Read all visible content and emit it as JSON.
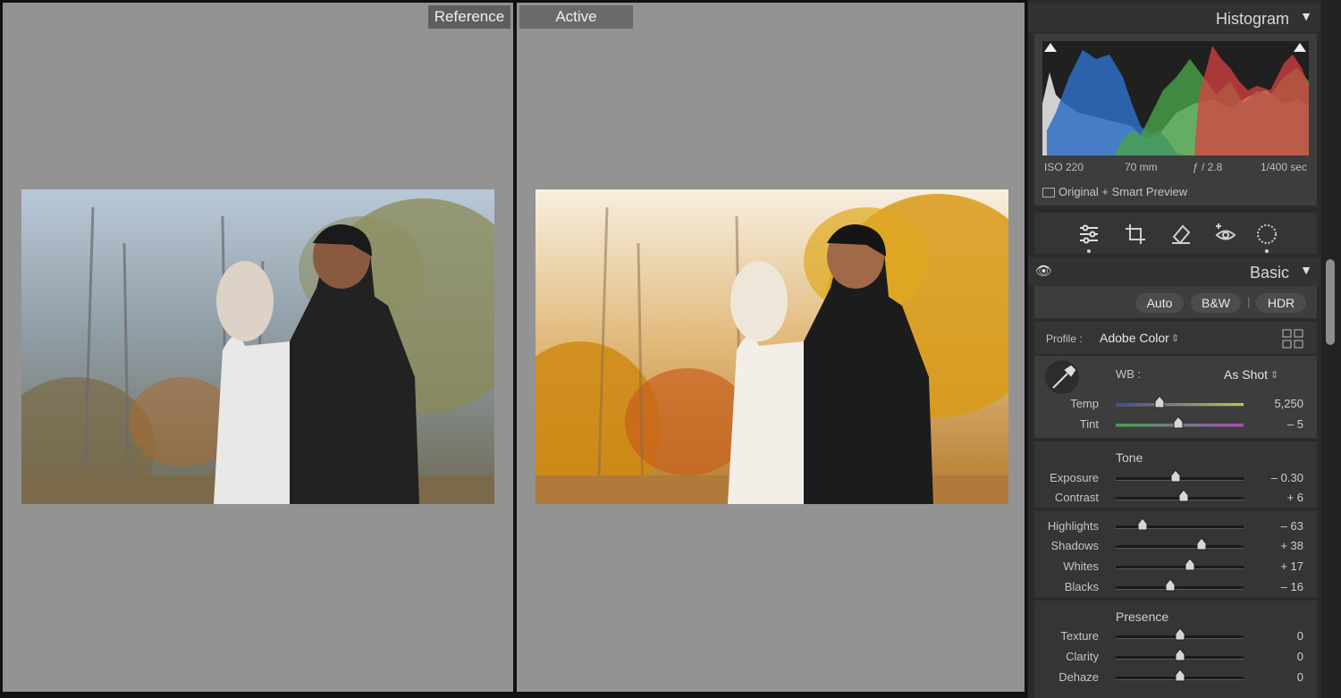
{
  "compare": {
    "reference_label": "Reference",
    "active_label": "Active"
  },
  "histogram": {
    "title": "Histogram",
    "iso": "ISO 220",
    "focal": "70 mm",
    "aperture": "ƒ / 2.8",
    "shutter": "1/400 sec",
    "preview": "Original + Smart Preview"
  },
  "tools": [
    "edit-icon",
    "crop-icon",
    "heal-icon",
    "redeye-icon",
    "mask-icon"
  ],
  "basic": {
    "title": "Basic",
    "auto": "Auto",
    "bw": "B&W",
    "separator": "|",
    "hdr": "HDR",
    "profile_label": "Profile :",
    "profile_value": "Adobe Color",
    "wb_label": "WB :",
    "wb_value": "As Shot",
    "temp": {
      "label": "Temp",
      "value": "5,250",
      "position": 0.34
    },
    "tint": {
      "label": "Tint",
      "value": "– 5",
      "position": 0.49
    },
    "tone_title": "Tone",
    "exposure": {
      "label": "Exposure",
      "value": "– 0.30",
      "position": 0.47
    },
    "contrast": {
      "label": "Contrast",
      "value": "+ 6",
      "position": 0.53
    },
    "highlights": {
      "label": "Highlights",
      "value": "– 63",
      "position": 0.21
    },
    "shadows": {
      "label": "Shadows",
      "value": "+ 38",
      "position": 0.67
    },
    "whites": {
      "label": "Whites",
      "value": "+ 17",
      "position": 0.58
    },
    "blacks": {
      "label": "Blacks",
      "value": "– 16",
      "position": 0.43
    },
    "presence_title": "Presence",
    "texture": {
      "label": "Texture",
      "value": "0",
      "position": 0.5
    },
    "clarity": {
      "label": "Clarity",
      "value": "0",
      "position": 0.5
    },
    "dehaze": {
      "label": "Dehaze",
      "value": "0",
      "position": 0.5
    }
  },
  "colors": {
    "panel_bg": "#2b2b2b",
    "view_bg": "#939393",
    "hist_red": "#d84040",
    "hist_green": "#4aa24a",
    "hist_blue": "#2e6fc4"
  }
}
